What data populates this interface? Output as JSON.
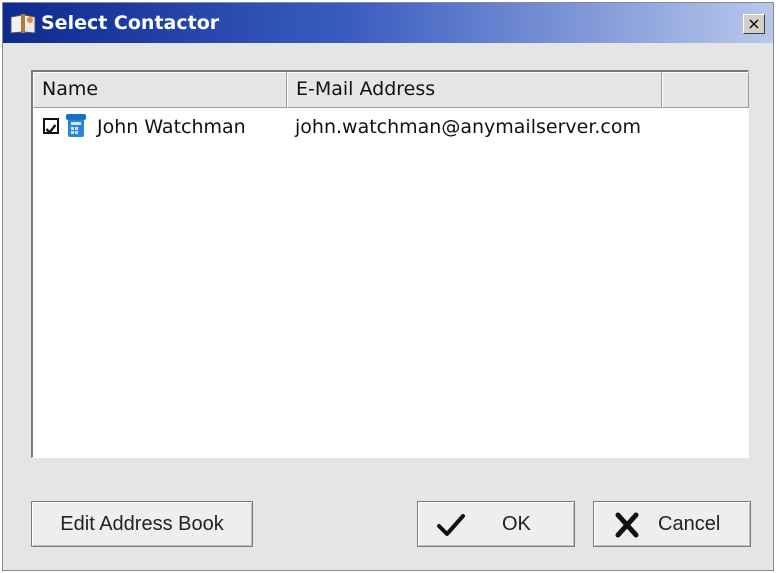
{
  "window": {
    "title": "Select Contactor",
    "close_label": "×"
  },
  "list": {
    "columns": [
      "Name",
      "E-Mail Address",
      ""
    ],
    "rows": [
      {
        "checked": true,
        "icon": "contact-phone-icon",
        "name": "John Watchman",
        "email": "john.watchman@anymailserver.com"
      }
    ]
  },
  "buttons": {
    "edit_address_book": "Edit Address Book",
    "ok": "OK",
    "cancel": "Cancel"
  },
  "colors": {
    "title_bar_start": "#0c2a8f",
    "title_bar_end": "#b8c8ec",
    "dialog_background": "#e5e5e5",
    "contact_icon": "#2a86d6"
  }
}
